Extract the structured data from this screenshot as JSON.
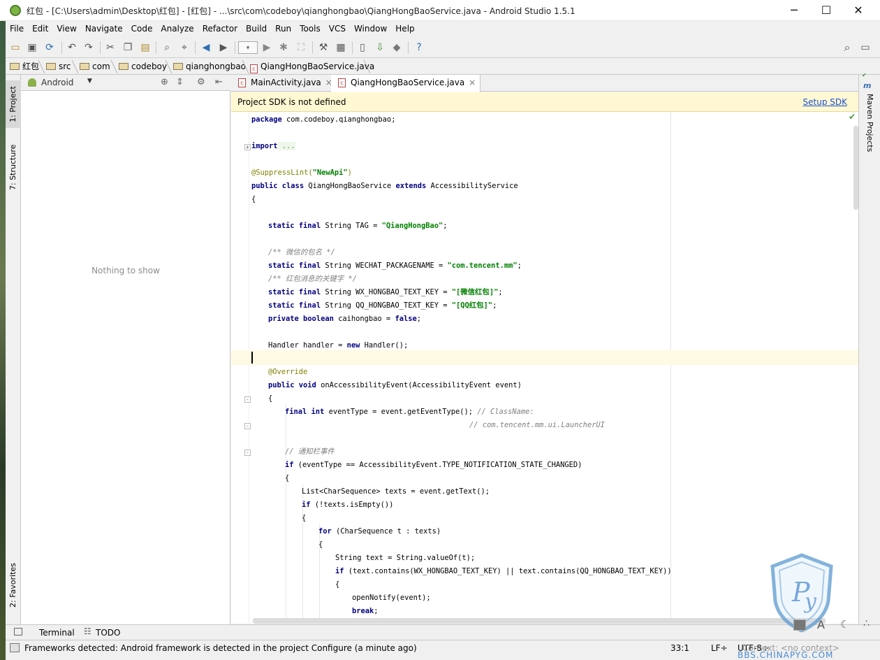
{
  "window": {
    "title": "红包 - [C:\\Users\\admin\\Desktop\\红包] - [红包] - ...\\src\\com\\codeboy\\qianghongbao\\QiangHongBaoService.java - Android Studio 1.5.1",
    "minimize": "─",
    "maximize": "☐",
    "close": "✕"
  },
  "menu": [
    "File",
    "Edit",
    "View",
    "Navigate",
    "Code",
    "Analyze",
    "Refactor",
    "Build",
    "Run",
    "Tools",
    "VCS",
    "Window",
    "Help"
  ],
  "breadcrumb": [
    "红包",
    "src",
    "com",
    "codeboy",
    "qianghongbao",
    "QiangHongBaoService.java"
  ],
  "project_panel": {
    "selector": "Android",
    "empty_text": "Nothing to show"
  },
  "left_tabs": {
    "project": "1: Project",
    "structure": "7: Structure",
    "favorites": "2: Favorites"
  },
  "right_tabs": {
    "maven": "Maven Projects"
  },
  "editor_tabs": [
    {
      "label": "MainActivity.java",
      "close": "×"
    },
    {
      "label": "QiangHongBaoService.java",
      "close": "×"
    }
  ],
  "sdk_banner": {
    "message": "Project SDK is not defined",
    "link": "Setup SDK"
  },
  "code": {
    "l1_kw": "package",
    "l1_rest": " com.codeboy.qianghongbao;",
    "l2_kw": "import",
    "l2_fold": " ...",
    "l3_ann": "@SuppressLint(",
    "l3_str": "\"NewApi\"",
    "l3_end": ")",
    "l4_kw": "public class",
    "l4_rest": " QiangHongBaoService ",
    "l4_kw2": "extends",
    "l4_rest2": " AccessibilityService",
    "l5": "{",
    "l6_kw": "static final",
    "l6_rest": " String TAG = ",
    "l6_str": "\"QiangHongBao\"",
    "l6_end": ";",
    "l7_cm": "/** 微信的包名 */",
    "l8_kw": "static final",
    "l8_rest": " String WECHAT_PACKAGENAME = ",
    "l8_str": "\"com.tencent.mm\"",
    "l8_end": ";",
    "l9_cm": "/** 红包消息的关键字 */",
    "l10_kw": "static final",
    "l10_rest": " String WX_HONGBAO_TEXT_KEY = ",
    "l10_str": "\"[微信红包]\"",
    "l10_end": ";",
    "l11_kw": "static final",
    "l11_rest": " String QQ_HONGBAO_TEXT_KEY = ",
    "l11_str": "\"[QQ红包]\"",
    "l11_end": ";",
    "l12_kw": "private boolean",
    "l12_rest": " caihongbao = ",
    "l12_kw2": "false",
    "l12_end": ";",
    "l13_a": "Handler handler = ",
    "l13_kw": "new",
    "l13_b": " Handler();",
    "l14_ann": "@Override",
    "l15_kw": "public void",
    "l15_rest": " onAccessibilityEvent(AccessibilityEvent event)",
    "l16": "{",
    "l17_kw": "final int",
    "l17_rest": " eventType = event.getEventType(); ",
    "l17_cm": "// ClassName:",
    "l18_cm": "// com.tencent.mm.ui.LauncherUI",
    "l19_cm": "// 通知栏事件",
    "l20_kw": "if",
    "l20_rest": " (eventType == AccessibilityEvent.TYPE_NOTIFICATION_STATE_CHANGED)",
    "l21": "{",
    "l22": "List<CharSequence> texts = event.getText();",
    "l23_kw": "if",
    "l23_rest": " (!texts.isEmpty())",
    "l24": "{",
    "l25_kw": "for",
    "l25_rest": " (CharSequence t : texts)",
    "l26": "{",
    "l27": "String text = String.valueOf(t);",
    "l28_kw": "if",
    "l28_rest": " (text.contains(WX_HONGBAO_TEXT_KEY) || text.contains(QQ_HONGBAO_TEXT_KEY))",
    "l29": "{",
    "l30": "openNotify(event);",
    "l31_kw": "break",
    "l31_end": ";"
  },
  "bottom_tabs": {
    "terminal": "Terminal",
    "todo": "TODO"
  },
  "status": {
    "message": "Frameworks detected: Android framework is detected in the project Configure (a minute ago)",
    "position": "33:1",
    "line_sep": "LF÷",
    "encoding": "UTF-8÷",
    "context": "Context: <no context>"
  },
  "watermark": "BBS.CHINAPYG.COM",
  "colors": {
    "banner_bg": "#fff8d2",
    "keyword": "#000080",
    "string": "#008000",
    "comment": "#808080",
    "link": "#1a4fcf"
  }
}
